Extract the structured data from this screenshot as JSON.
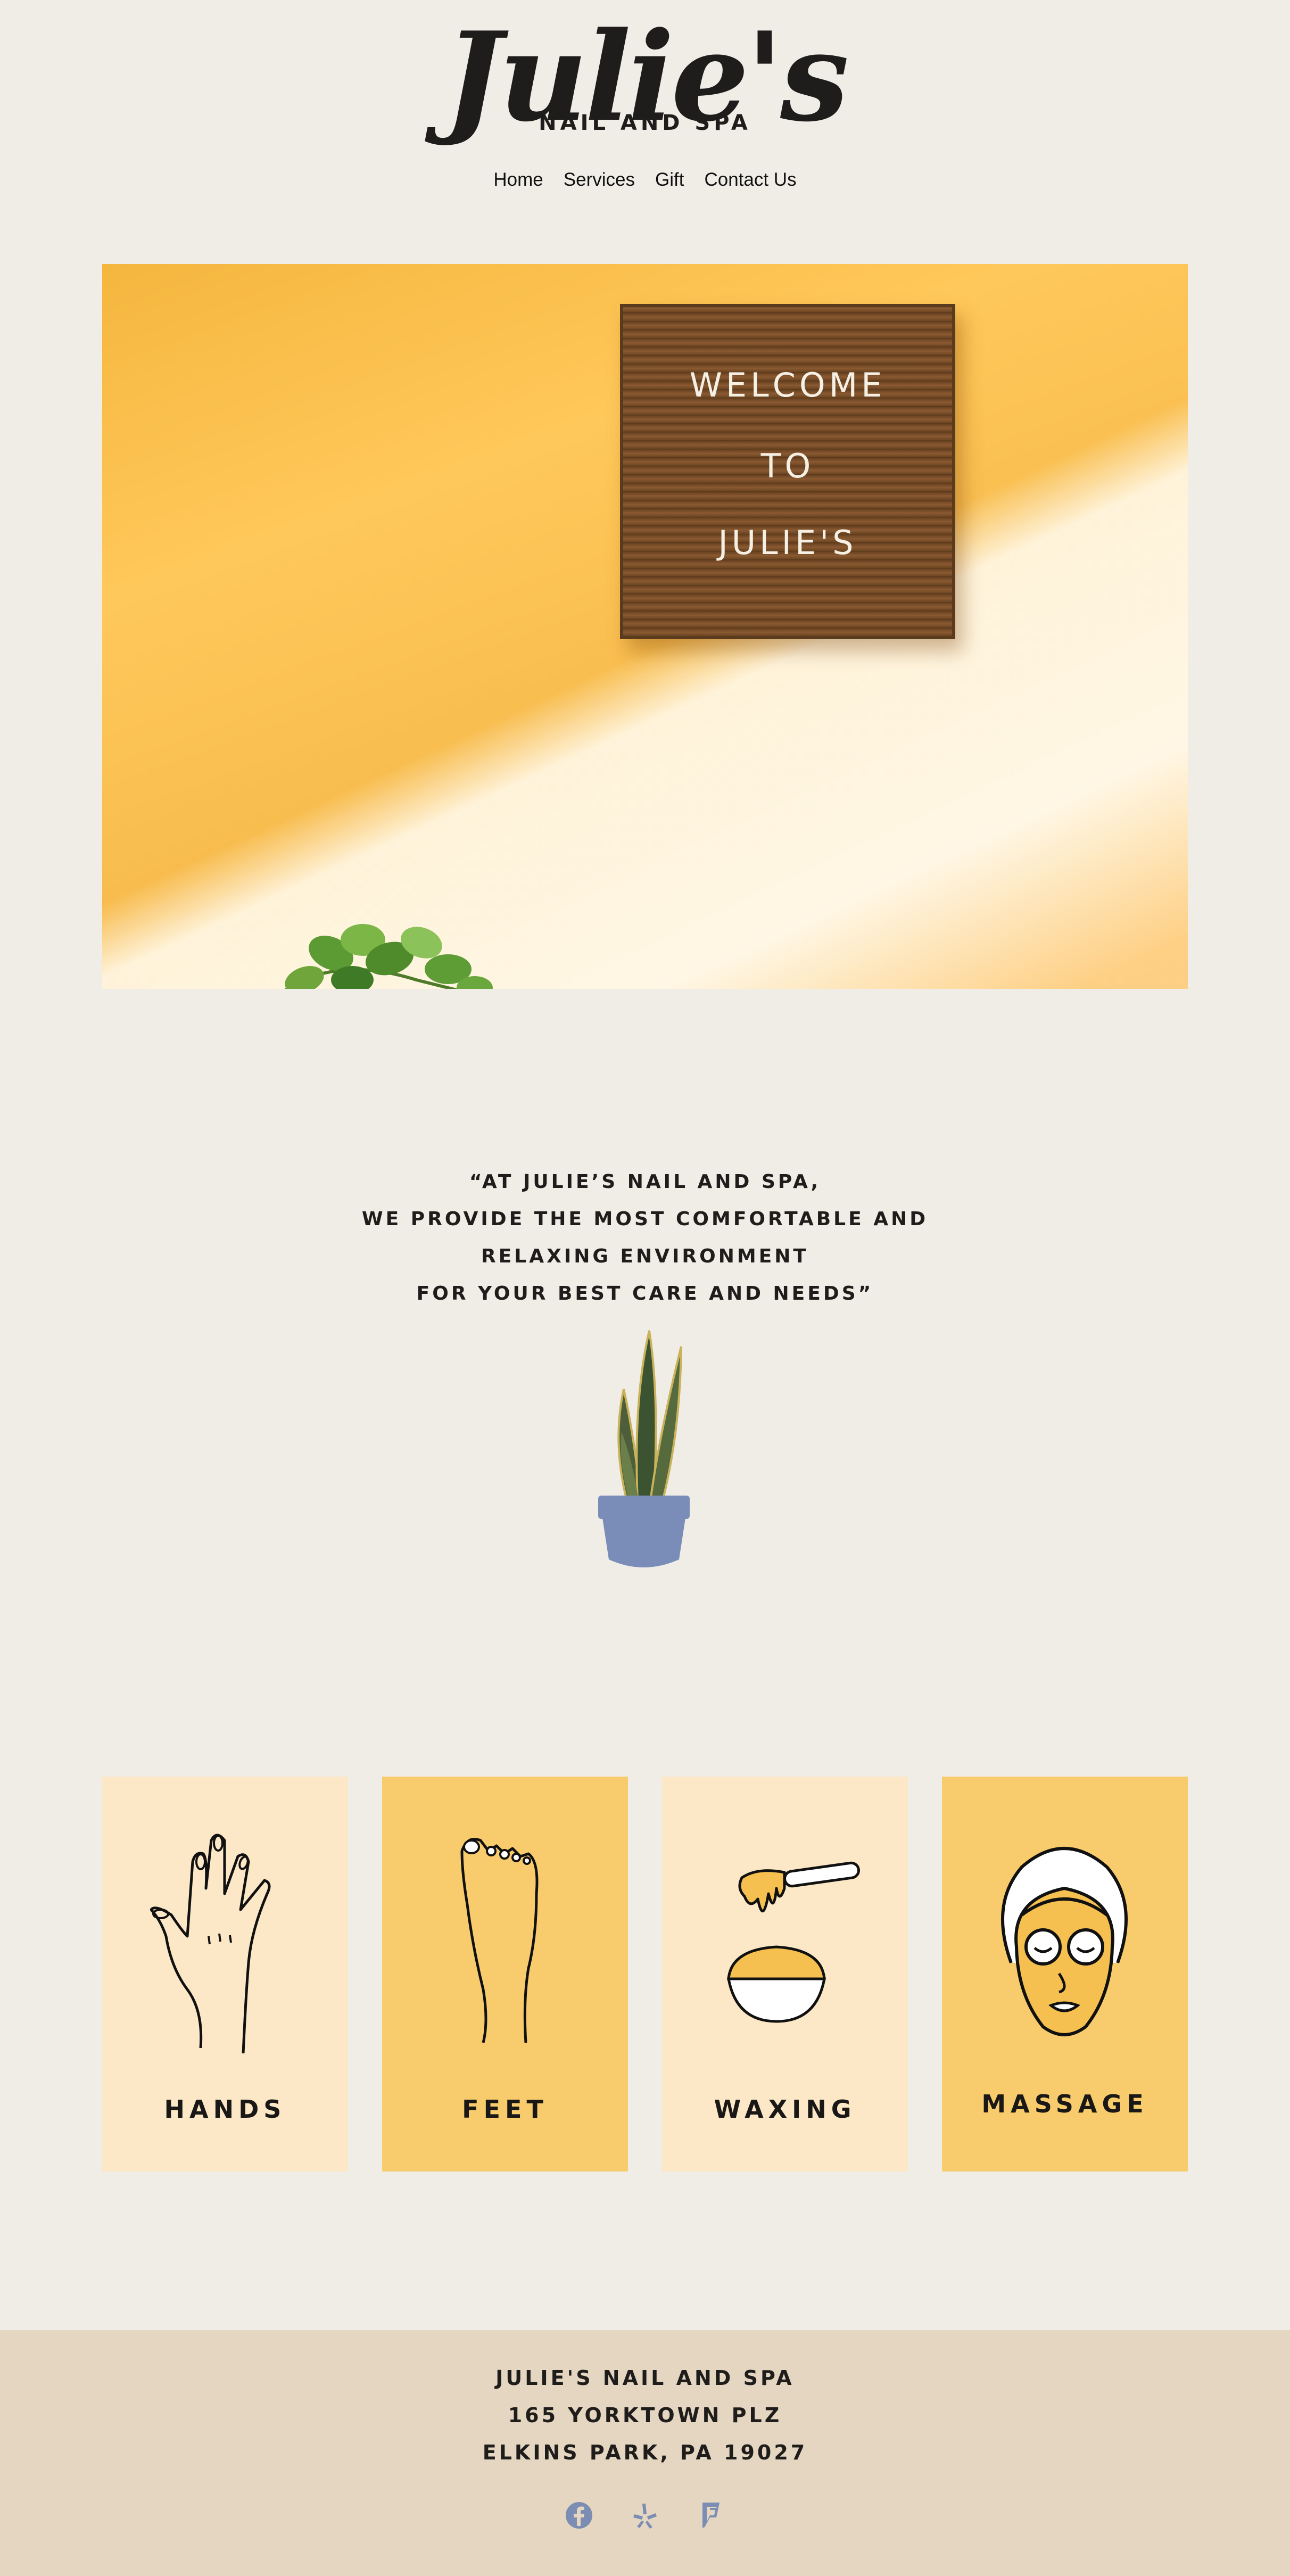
{
  "brand": {
    "name": "Julie's",
    "tagline": "NAIL AND SPA"
  },
  "nav": {
    "items": [
      "Home",
      "Services",
      "Gift",
      "Contact Us"
    ]
  },
  "hero": {
    "sign_lines": [
      "WELCOME",
      "TO",
      "JULIE'S"
    ]
  },
  "quote": {
    "lines": [
      "“AT JULIE’S NAIL AND SPA,",
      "WE PROVIDE THE MOST COMFORTABLE AND",
      "RELAXING ENVIRONMENT",
      "FOR YOUR BEST CARE AND NEEDS”"
    ]
  },
  "services": [
    {
      "label": "HANDS",
      "icon": "hand-icon"
    },
    {
      "label": "FEET",
      "icon": "foot-icon"
    },
    {
      "label": "WAXING",
      "icon": "wax-icon"
    },
    {
      "label": "MASSAGE",
      "icon": "face-mask-icon"
    }
  ],
  "footer": {
    "lines": [
      "JULIE'S NAIL AND SPA",
      "165 YORKTOWN PLZ",
      "ELKINS PARK, PA 19027"
    ],
    "social": [
      "facebook-icon",
      "yelp-icon",
      "foursquare-icon"
    ]
  },
  "colors": {
    "background": "#f0ede7",
    "card_light": "#fce8c6",
    "card_dark": "#f8cc6c",
    "footer_bg": "#e4d6c0",
    "social_icon": "#7b8db3"
  }
}
